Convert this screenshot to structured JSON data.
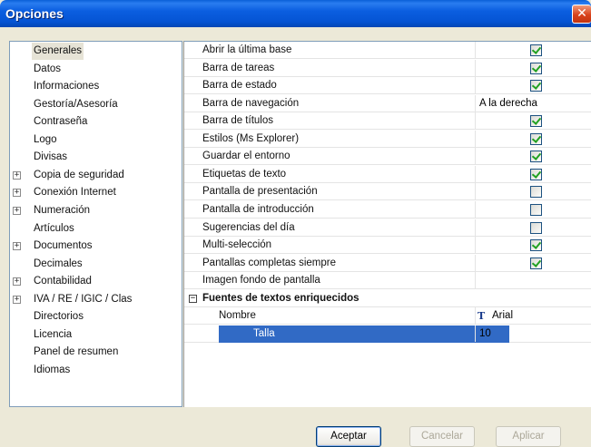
{
  "window": {
    "title": "Opciones",
    "close_glyph": "✕"
  },
  "tree": {
    "items": [
      {
        "label": "Generales",
        "expandable": false,
        "selected": true
      },
      {
        "label": "Datos",
        "expandable": false
      },
      {
        "label": "Informaciones",
        "expandable": false
      },
      {
        "label": "Gestoría/Asesoría",
        "expandable": false
      },
      {
        "label": "Contraseña",
        "expandable": false
      },
      {
        "label": "Logo",
        "expandable": false
      },
      {
        "label": "Divisas",
        "expandable": false
      },
      {
        "label": "Copia de seguridad",
        "expandable": true
      },
      {
        "label": "Conexión Internet",
        "expandable": true
      },
      {
        "label": "Numeración",
        "expandable": true
      },
      {
        "label": "Artículos",
        "expandable": false
      },
      {
        "label": "Documentos",
        "expandable": true
      },
      {
        "label": "Decimales",
        "expandable": false
      },
      {
        "label": "Contabilidad",
        "expandable": true
      },
      {
        "label": "IVA / RE / IGIC / Clas",
        "expandable": true
      },
      {
        "label": "Directorios",
        "expandable": false
      },
      {
        "label": "Licencia",
        "expandable": false
      },
      {
        "label": "Panel de resumen",
        "expandable": false
      },
      {
        "label": "Idiomas",
        "expandable": false
      }
    ],
    "expand_glyph": "+"
  },
  "properties": {
    "rows": [
      {
        "name": "Abrir la última base",
        "checked": true
      },
      {
        "name": "Barra de tareas",
        "checked": true
      },
      {
        "name": "Barra de estado",
        "checked": true
      },
      {
        "name": "Barra de navegación",
        "value": "A la derecha"
      },
      {
        "name": "Barra de títulos",
        "checked": true
      },
      {
        "name": "Estilos (Ms Explorer)",
        "checked": true
      },
      {
        "name": "Guardar el entorno",
        "checked": true
      },
      {
        "name": "Etiquetas de texto",
        "checked": true
      },
      {
        "name": "Pantalla de presentación",
        "checked": false
      },
      {
        "name": "Pantalla de introducción",
        "checked": false
      },
      {
        "name": "Sugerencias del día",
        "checked": false
      },
      {
        "name": "Multi-selección",
        "checked": true
      },
      {
        "name": "Pantallas completas siempre",
        "checked": true
      },
      {
        "name": "Imagen fondo de pantalla",
        "value": ""
      }
    ],
    "category": {
      "label": "Fuentes de textos enriquecidos",
      "collapse_glyph": "−"
    },
    "sub_rows": [
      {
        "name": "Nombre",
        "value": "Arial",
        "icon": "truetype-font-icon",
        "icon_glyph": "T"
      },
      {
        "name": "Talla",
        "value": "10",
        "selected": true
      }
    ]
  },
  "buttons": {
    "accept": "Aceptar",
    "cancel": "Cancelar",
    "apply": "Aplicar"
  }
}
